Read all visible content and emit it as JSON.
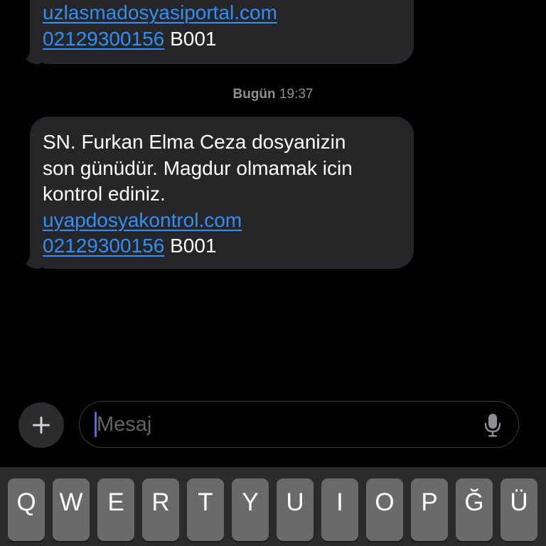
{
  "messages": [
    {
      "lines": [
        {
          "parts": [
            {
              "text": "uzlasmadosyasiportal.com",
              "link": true
            }
          ]
        },
        {
          "parts": [
            {
              "text": "02129300156",
              "link": true
            },
            {
              "text": " B001",
              "link": false
            }
          ]
        }
      ]
    },
    {
      "lines": [
        {
          "parts": [
            {
              "text": "SN. Furkan Elma Ceza dosyanizin",
              "link": false
            }
          ]
        },
        {
          "parts": [
            {
              "text": "son günüdür. Magdur olmamak icin",
              "link": false
            }
          ]
        },
        {
          "parts": [
            {
              "text": "kontrol ediniz.",
              "link": false
            }
          ]
        },
        {
          "parts": [
            {
              "text": "uyapdosyakontrol.com",
              "link": true
            }
          ]
        },
        {
          "parts": [
            {
              "text": "02129300156",
              "link": true
            },
            {
              "text": " B001",
              "link": false
            }
          ]
        }
      ]
    }
  ],
  "timestamp": {
    "day": "Bugün",
    "time": " 19:37"
  },
  "composer": {
    "placeholder": "Mesaj",
    "value": "",
    "add_icon": "plus-icon",
    "mic_icon": "microphone-icon"
  },
  "keyboard": {
    "keys": [
      "Q",
      "W",
      "E",
      "R",
      "T",
      "Y",
      "U",
      "I",
      "O",
      "P",
      "Ğ",
      "Ü"
    ]
  },
  "colors": {
    "background": "#000000",
    "bubble": "#262628",
    "link": "#2f8ff7",
    "timestamp": "#8e8e93",
    "key": "#6a6a6a",
    "keyboard": "#2b2b2b",
    "cursor": "#4f63ff"
  }
}
